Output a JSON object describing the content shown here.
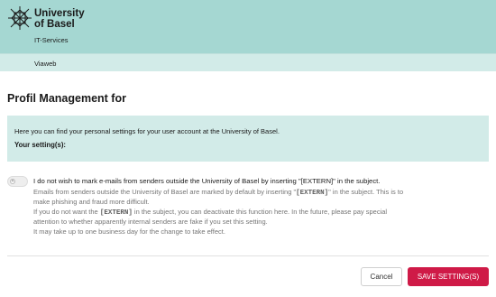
{
  "header": {
    "logo_line1": "University",
    "logo_line2": "of Basel",
    "department": "IT-Services",
    "subnav_item": "Viaweb"
  },
  "page": {
    "title": "Profil Management for"
  },
  "info_box": {
    "text": "Here you can find your personal settings for your user account at the University of Basel.",
    "settings_heading": "Your setting(s):"
  },
  "setting": {
    "toggle_state": "off",
    "toggle_symbol": "✕",
    "title": "I do not wish to mark e-mails from senders outside the University of Basel by inserting \"[EXTERN]\" in the subject.",
    "desc_line1_a": "Emails from senders outside the University of Basel are marked by default by inserting \"",
    "desc_line1_code": "[EXTERN]",
    "desc_line1_b": "\" in the subject. This is to",
    "desc_line2": "make phishing and fraud more difficult.",
    "desc_line3_a": "If you do not want the ",
    "desc_line3_code": "[EXTERN]",
    "desc_line3_b": " in the subject, you can deactivate this function here. In the future, please pay special",
    "desc_line4": "attention to whether apparently internal senders are fake if you set this setting.",
    "desc_line5": "It may take up to one business day for the change to take effect."
  },
  "actions": {
    "cancel_label": "Cancel",
    "save_label": "SAVE SETTING(S)"
  },
  "colors": {
    "header_bg": "#a5d7d2",
    "subnav_bg": "#d2ebe8",
    "info_bg": "#d2ebe8",
    "save_button": "#cf1a47"
  },
  "icons": {
    "logo": "university-of-basel-star-logo",
    "toggle": "toggle-off-x"
  }
}
